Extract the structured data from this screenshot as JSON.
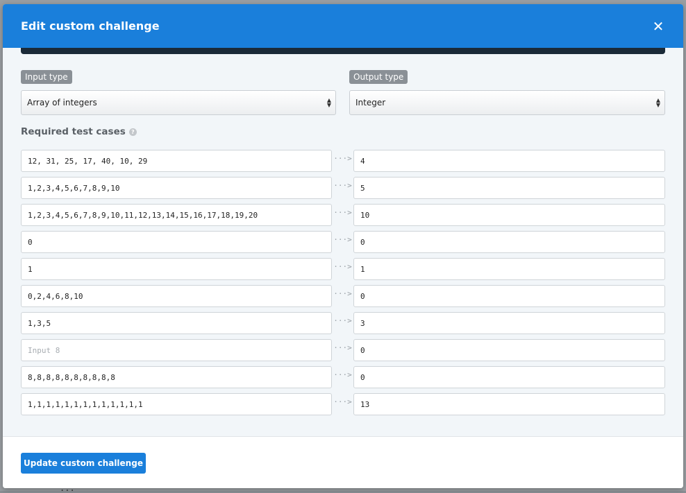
{
  "modal": {
    "title": "Edit custom challenge",
    "close_icon": "close-icon"
  },
  "input_type": {
    "label": "Input type",
    "selected": "Array of integers"
  },
  "output_type": {
    "label": "Output type",
    "selected": "Integer"
  },
  "test_cases": {
    "title": "Required test cases",
    "rows": [
      {
        "input": "12, 31, 25, 17, 40, 10, 29",
        "output": "4"
      },
      {
        "input": "1,2,3,4,5,6,7,8,9,10",
        "output": "5"
      },
      {
        "input": "1,2,3,4,5,6,7,8,9,10,11,12,13,14,15,16,17,18,19,20",
        "output": "10"
      },
      {
        "input": "0",
        "output": "0"
      },
      {
        "input": "1",
        "output": "1"
      },
      {
        "input": "0,2,4,6,8,10",
        "output": "0"
      },
      {
        "input": "1,3,5",
        "output": "3"
      },
      {
        "input": "",
        "placeholder": "Input 8",
        "output": "0"
      },
      {
        "input": "8,8,8,8,8,8,8,8,8,8",
        "output": "0"
      },
      {
        "input": "1,1,1,1,1,1,1,1,1,1,1,1,1",
        "output": "13"
      }
    ],
    "arrow": "···>"
  },
  "footer": {
    "update_label": "Update custom challenge"
  },
  "colors": {
    "header": "#1a7fdb",
    "button": "#1a7fdb",
    "modal_bg": "#f2f6f9"
  }
}
